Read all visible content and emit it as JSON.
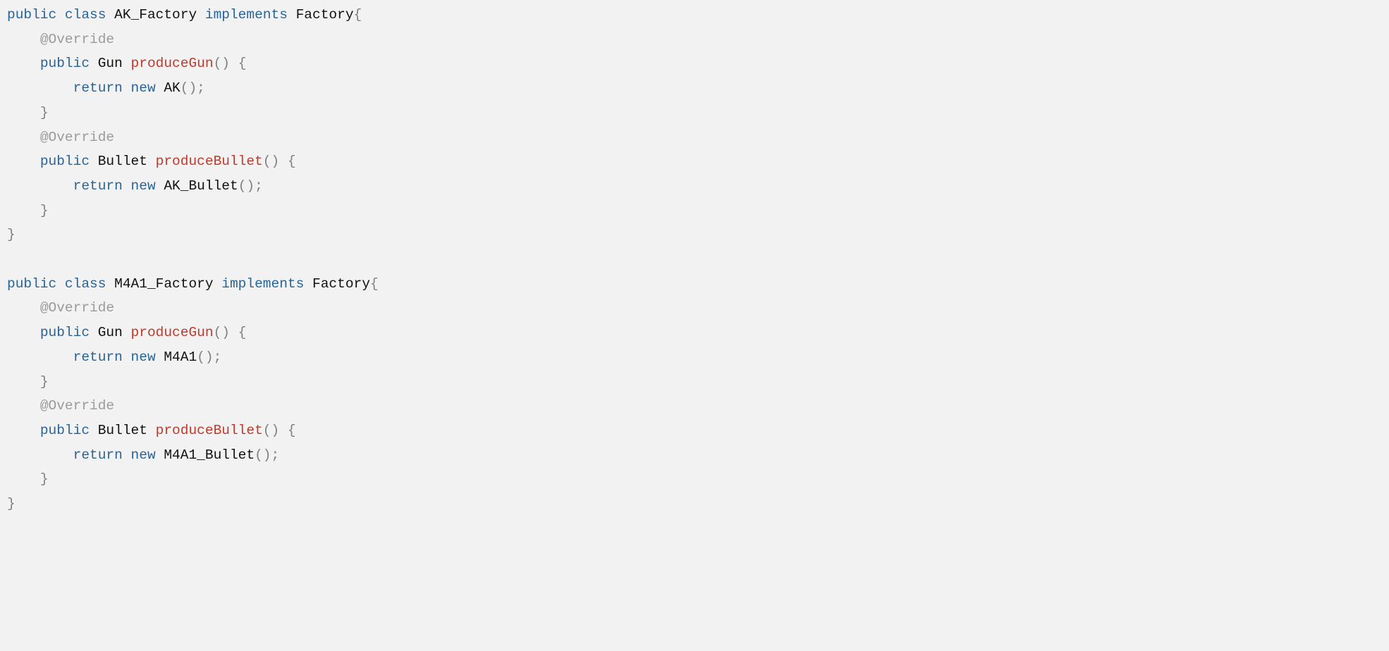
{
  "code": {
    "classes": [
      {
        "name": "AK_Factory",
        "implements": "Factory",
        "methods": [
          {
            "annotation": "@Override",
            "modifier": "public",
            "returnType": "Gun",
            "name": "produceGun",
            "returnExpr": {
              "keyword": "new",
              "ctor": "AK"
            }
          },
          {
            "annotation": "@Override",
            "modifier": "public",
            "returnType": "Bullet",
            "name": "produceBullet",
            "returnExpr": {
              "keyword": "new",
              "ctor": "AK_Bullet"
            }
          }
        ]
      },
      {
        "name": "M4A1_Factory",
        "implements": "Factory",
        "methods": [
          {
            "annotation": "@Override",
            "modifier": "public",
            "returnType": "Gun",
            "name": "produceGun",
            "returnExpr": {
              "keyword": "new",
              "ctor": "M4A1"
            }
          },
          {
            "annotation": "@Override",
            "modifier": "public",
            "returnType": "Bullet",
            "name": "produceBullet",
            "returnExpr": {
              "keyword": "new",
              "ctor": "M4A1_Bullet"
            }
          }
        ]
      }
    ],
    "keywords": {
      "public": "public",
      "class": "class",
      "implements": "implements",
      "return": "return",
      "new": "new"
    }
  }
}
